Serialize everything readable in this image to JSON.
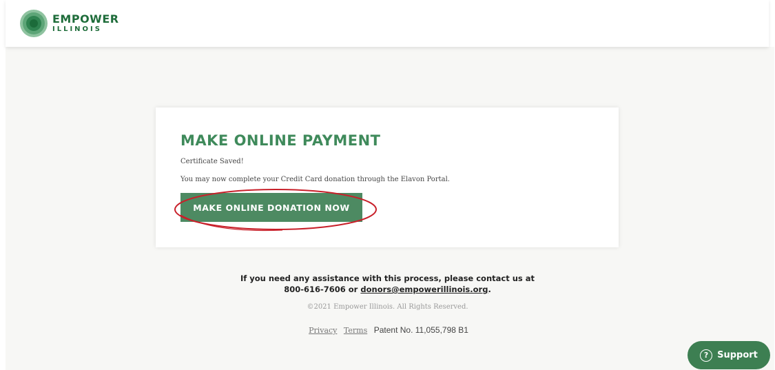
{
  "header": {
    "logo_line1": "EMPOWER",
    "logo_line2": "ILLINOIS"
  },
  "card": {
    "title": "MAKE ONLINE PAYMENT",
    "status_message": "Certificate Saved!",
    "instruction_message": "You may now complete your Credit Card donation through the Elavon Portal.",
    "donate_button_label": "MAKE ONLINE DONATION NOW"
  },
  "footer": {
    "assist_line1": "If you need any assistance with this process, please contact us at",
    "phone": "800-616-7606",
    "or": "or",
    "email": "donors@empowerillinois.org",
    "period": ".",
    "copyright": "©2021 Empower Illinois. All Rights Reserved.",
    "privacy_label": "Privacy",
    "terms_label": "Terms",
    "patent": "Patent No. 11,055,798 B1"
  },
  "support": {
    "label": "Support",
    "icon": "?"
  },
  "colors": {
    "brand_green": "#4d8a62",
    "title_green": "#3f8a5b",
    "annotation_red": "#c8202a"
  }
}
